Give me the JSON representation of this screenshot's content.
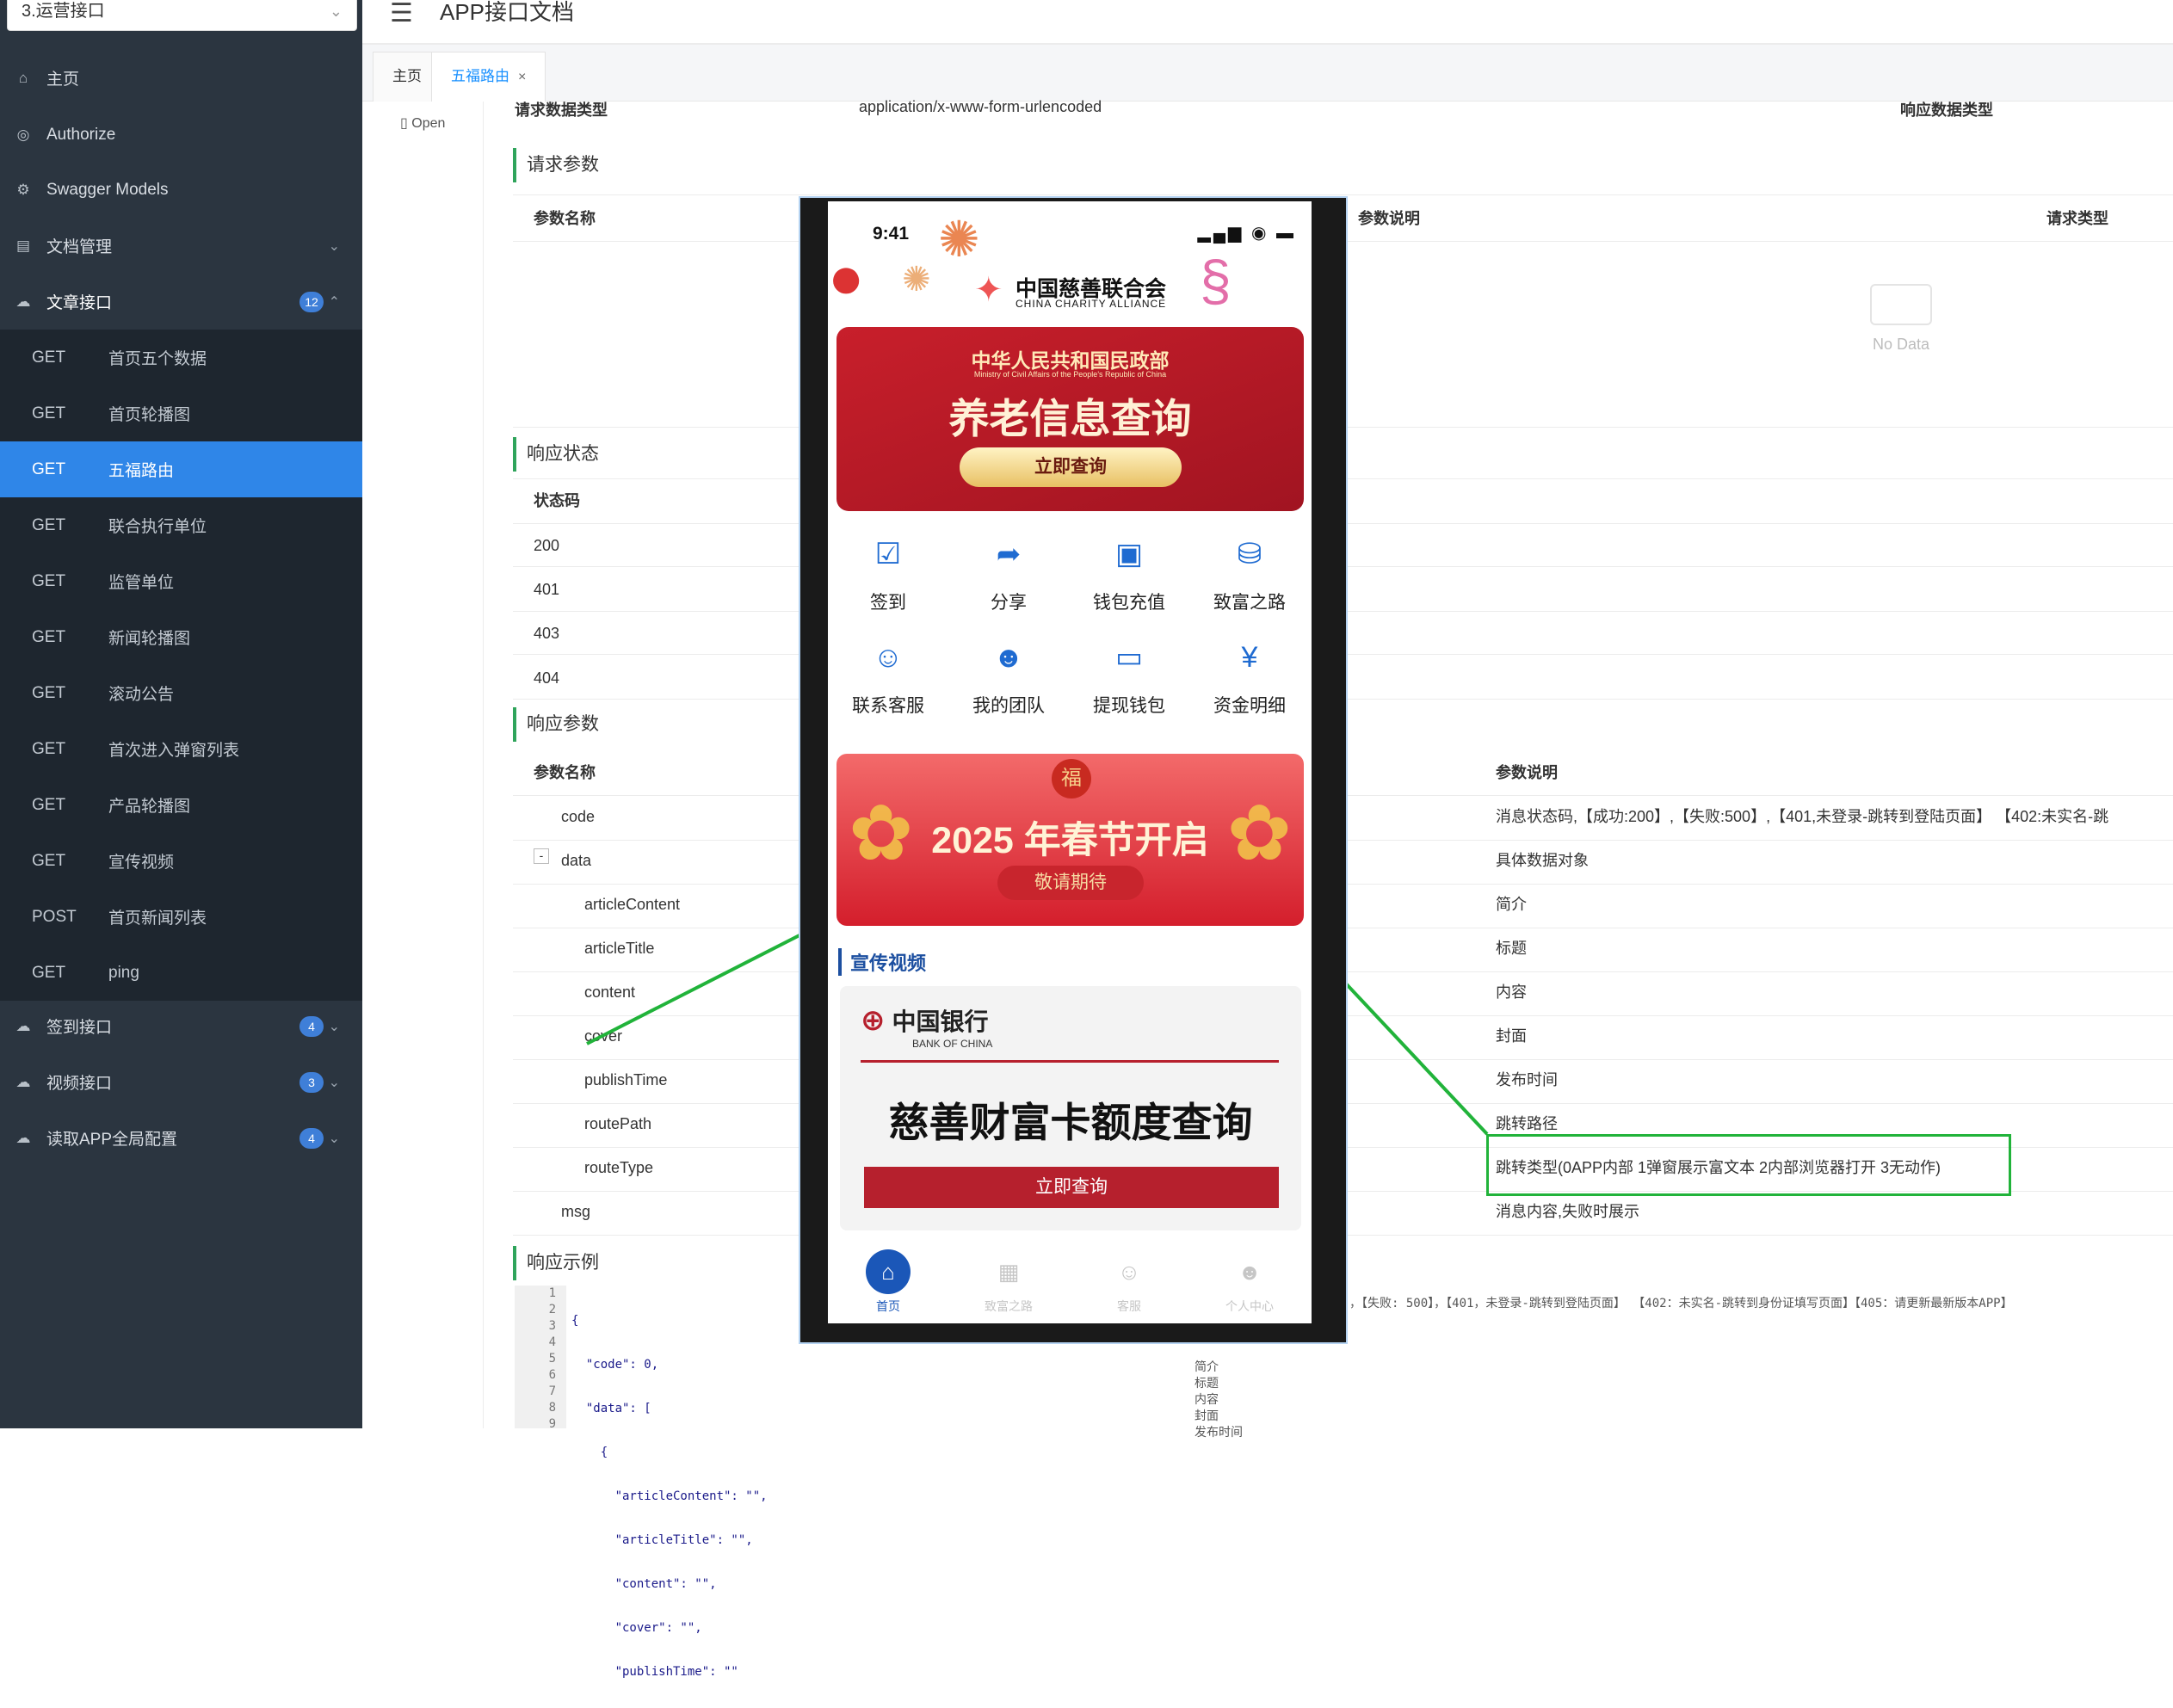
{
  "sidebar": {
    "group_select": "3.运营接口",
    "top": [
      {
        "icon": "home-icon",
        "label": "主页"
      },
      {
        "icon": "lock-icon",
        "label": "Authorize"
      },
      {
        "icon": "model-icon",
        "label": "Swagger Models"
      },
      {
        "icon": "document-icon",
        "label": "文档管理"
      },
      {
        "icon": "cloud-icon",
        "label": "文章接口",
        "badge": "12"
      }
    ],
    "apis": [
      {
        "method": "GET",
        "label": "首页五个数据"
      },
      {
        "method": "GET",
        "label": "首页轮播图"
      },
      {
        "method": "GET",
        "label": "五福路由"
      },
      {
        "method": "GET",
        "label": "联合执行单位"
      },
      {
        "method": "GET",
        "label": "监管单位"
      },
      {
        "method": "GET",
        "label": "新闻轮播图"
      },
      {
        "method": "GET",
        "label": "滚动公告"
      },
      {
        "method": "GET",
        "label": "首次进入弹窗列表"
      },
      {
        "method": "GET",
        "label": "产品轮播图"
      },
      {
        "method": "GET",
        "label": "宣传视频"
      },
      {
        "method": "POST",
        "label": "首页新闻列表"
      },
      {
        "method": "GET",
        "label": "ping"
      }
    ],
    "bottom": [
      {
        "label": "签到接口",
        "badge": "4"
      },
      {
        "label": "视频接口",
        "badge": "3"
      },
      {
        "label": "读取APP全局配置",
        "badge": "4"
      }
    ]
  },
  "header": {
    "title": "APP接口文档"
  },
  "tabs": {
    "home": "主页",
    "current": "五福路由",
    "close": "×"
  },
  "open_label": "Open",
  "content": {
    "req_type_label": "请求数据类型",
    "req_type_value": "application/x-www-form-urlencoded",
    "resp_type_label": "响应数据类型",
    "req_params_title": "请求参数",
    "req_params_headers": [
      "参数名称",
      "参数说明",
      "请求类型"
    ],
    "no_data": "No Data",
    "resp_status_title": "响应状态",
    "status_header": "状态码",
    "status_codes": [
      "200",
      "401",
      "403",
      "404"
    ],
    "resp_params_title": "响应参数",
    "resp_params_headers": [
      "参数名称",
      "参数说明"
    ],
    "resp_params": [
      {
        "name": "code",
        "desc": "消息状态码,【成功:200】,【失败:500】,【401,未登录-跳转到登陆页面】 【402:未实名-跳"
      },
      {
        "name": "data",
        "desc": "具体数据对象",
        "toggle": "-"
      },
      {
        "name": "articleContent",
        "desc": "简介"
      },
      {
        "name": "articleTitle",
        "desc": "标题"
      },
      {
        "name": "content",
        "desc": "内容"
      },
      {
        "name": "cover",
        "desc": "封面"
      },
      {
        "name": "publishTime",
        "desc": "发布时间"
      },
      {
        "name": "routePath",
        "desc": "跳转路径"
      },
      {
        "name": "routeType",
        "desc": "跳转类型(0APP内部 1弹窗展示富文本 2内部浏览器打开 3无动作)"
      },
      {
        "name": "msg",
        "desc": "消息内容,失败时展示"
      }
    ],
    "example_title": "响应示例",
    "example_lines": [
      "1",
      "2",
      "3",
      "4",
      "5",
      "6",
      "7",
      "8",
      "9"
    ],
    "example_code": [
      "{",
      "  \"code\": 0,",
      "  \"data\": [",
      "    {",
      "      \"articleContent\": \"\",",
      "      \"articleTitle\": \"\",",
      "      \"content\": \"\",",
      "      \"cover\": \"\",",
      "      \"publishTime\": \"\""
    ],
    "example_right_comment": "，【失败: 500】，【401，未登录-跳转到登陆页面】 【402：未实名-跳转到身份证填写页面】【405：请更新最新版本APP】",
    "example_comments": [
      "简介",
      "标题",
      "内容",
      "封面",
      "发布时间"
    ]
  },
  "phone": {
    "time": "9:41",
    "logo_cn": "中国慈善联合会",
    "logo_en": "CHINA CHARITY ALLIANCE",
    "banner1_top": "中华人民共和国民政部",
    "banner1_sub": "Ministry of Civil Affairs of the People's Republic of China",
    "banner1_title": "养老信息查询",
    "banner1_btn": "立即查询",
    "grid": [
      "签到",
      "分享",
      "钱包充值",
      "致富之路",
      "联系客服",
      "我的团队",
      "提现钱包",
      "资金明细"
    ],
    "banner2_fu": "福",
    "banner2_title": "2025 年春节开启",
    "banner2_btn": "敬请期待",
    "section": "宣传视频",
    "boc_cn": "中国银行",
    "boc_en": "BANK OF CHINA",
    "card_title": "慈善财富卡额度查询",
    "card_btn": "立即查询",
    "tabbar": [
      "首页",
      "致富之路",
      "客服",
      "个人中心"
    ]
  },
  "colors": {
    "accent": "#2f86e8",
    "sidebar_bg": "#2b3540",
    "highlight": "#21b33a",
    "red": "#b6202d"
  }
}
